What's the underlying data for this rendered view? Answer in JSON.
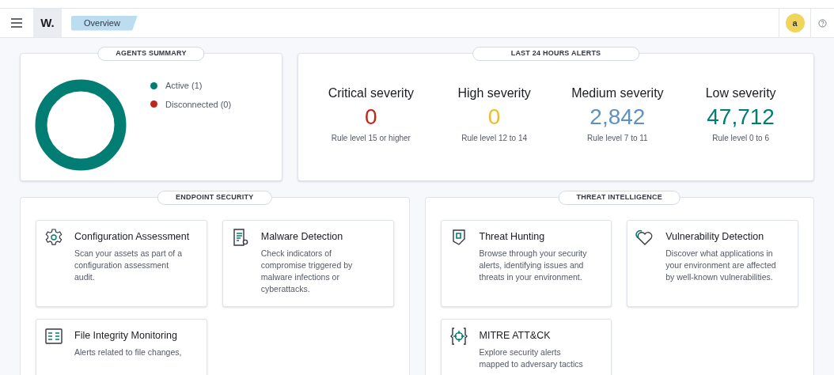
{
  "header": {
    "logo": "W.",
    "breadcrumb": "Overview",
    "avatar": "a"
  },
  "agents_summary": {
    "title": "AGENTS SUMMARY",
    "legend": [
      {
        "label": "Active (1)",
        "color": "#017d73"
      },
      {
        "label": "Disconnected (0)",
        "color": "#bd271e"
      }
    ]
  },
  "alerts": {
    "title": "LAST 24 HOURS ALERTS",
    "items": [
      {
        "label": "Critical severity",
        "value": "0",
        "color": "#bd271e",
        "caption": "Rule level 15 or higher"
      },
      {
        "label": "High severity",
        "value": "0",
        "color": "#e9bd2e",
        "caption": "Rule level 12 to 14"
      },
      {
        "label": "Medium severity",
        "value": "2,842",
        "color": "#6092c0",
        "caption": "Rule level 7 to 11"
      },
      {
        "label": "Low severity",
        "value": "47,712",
        "color": "#017d73",
        "caption": "Rule level 0 to 6"
      }
    ]
  },
  "sections": [
    {
      "title": "ENDPOINT SECURITY",
      "cards": [
        {
          "title": "Configuration Assessment",
          "description": "Scan your assets as part of a configuration assessment audit."
        },
        {
          "title": "Malware Detection",
          "description": "Check indicators of compromise triggered by malware infections or cyberattacks."
        },
        {
          "title": "File Integrity Monitoring",
          "description": "Alerts related to file changes,"
        }
      ]
    },
    {
      "title": "THREAT INTELLIGENCE",
      "cards": [
        {
          "title": "Threat Hunting",
          "description": "Browse through your security alerts, identifying issues and threats in your environment."
        },
        {
          "title": "Vulnerability Detection",
          "description": "Discover what applications in your environment are affected by well-known vulnerabilities."
        },
        {
          "title": "MITRE ATT&CK",
          "description": "Explore security alerts mapped to adversary tactics"
        }
      ]
    }
  ]
}
